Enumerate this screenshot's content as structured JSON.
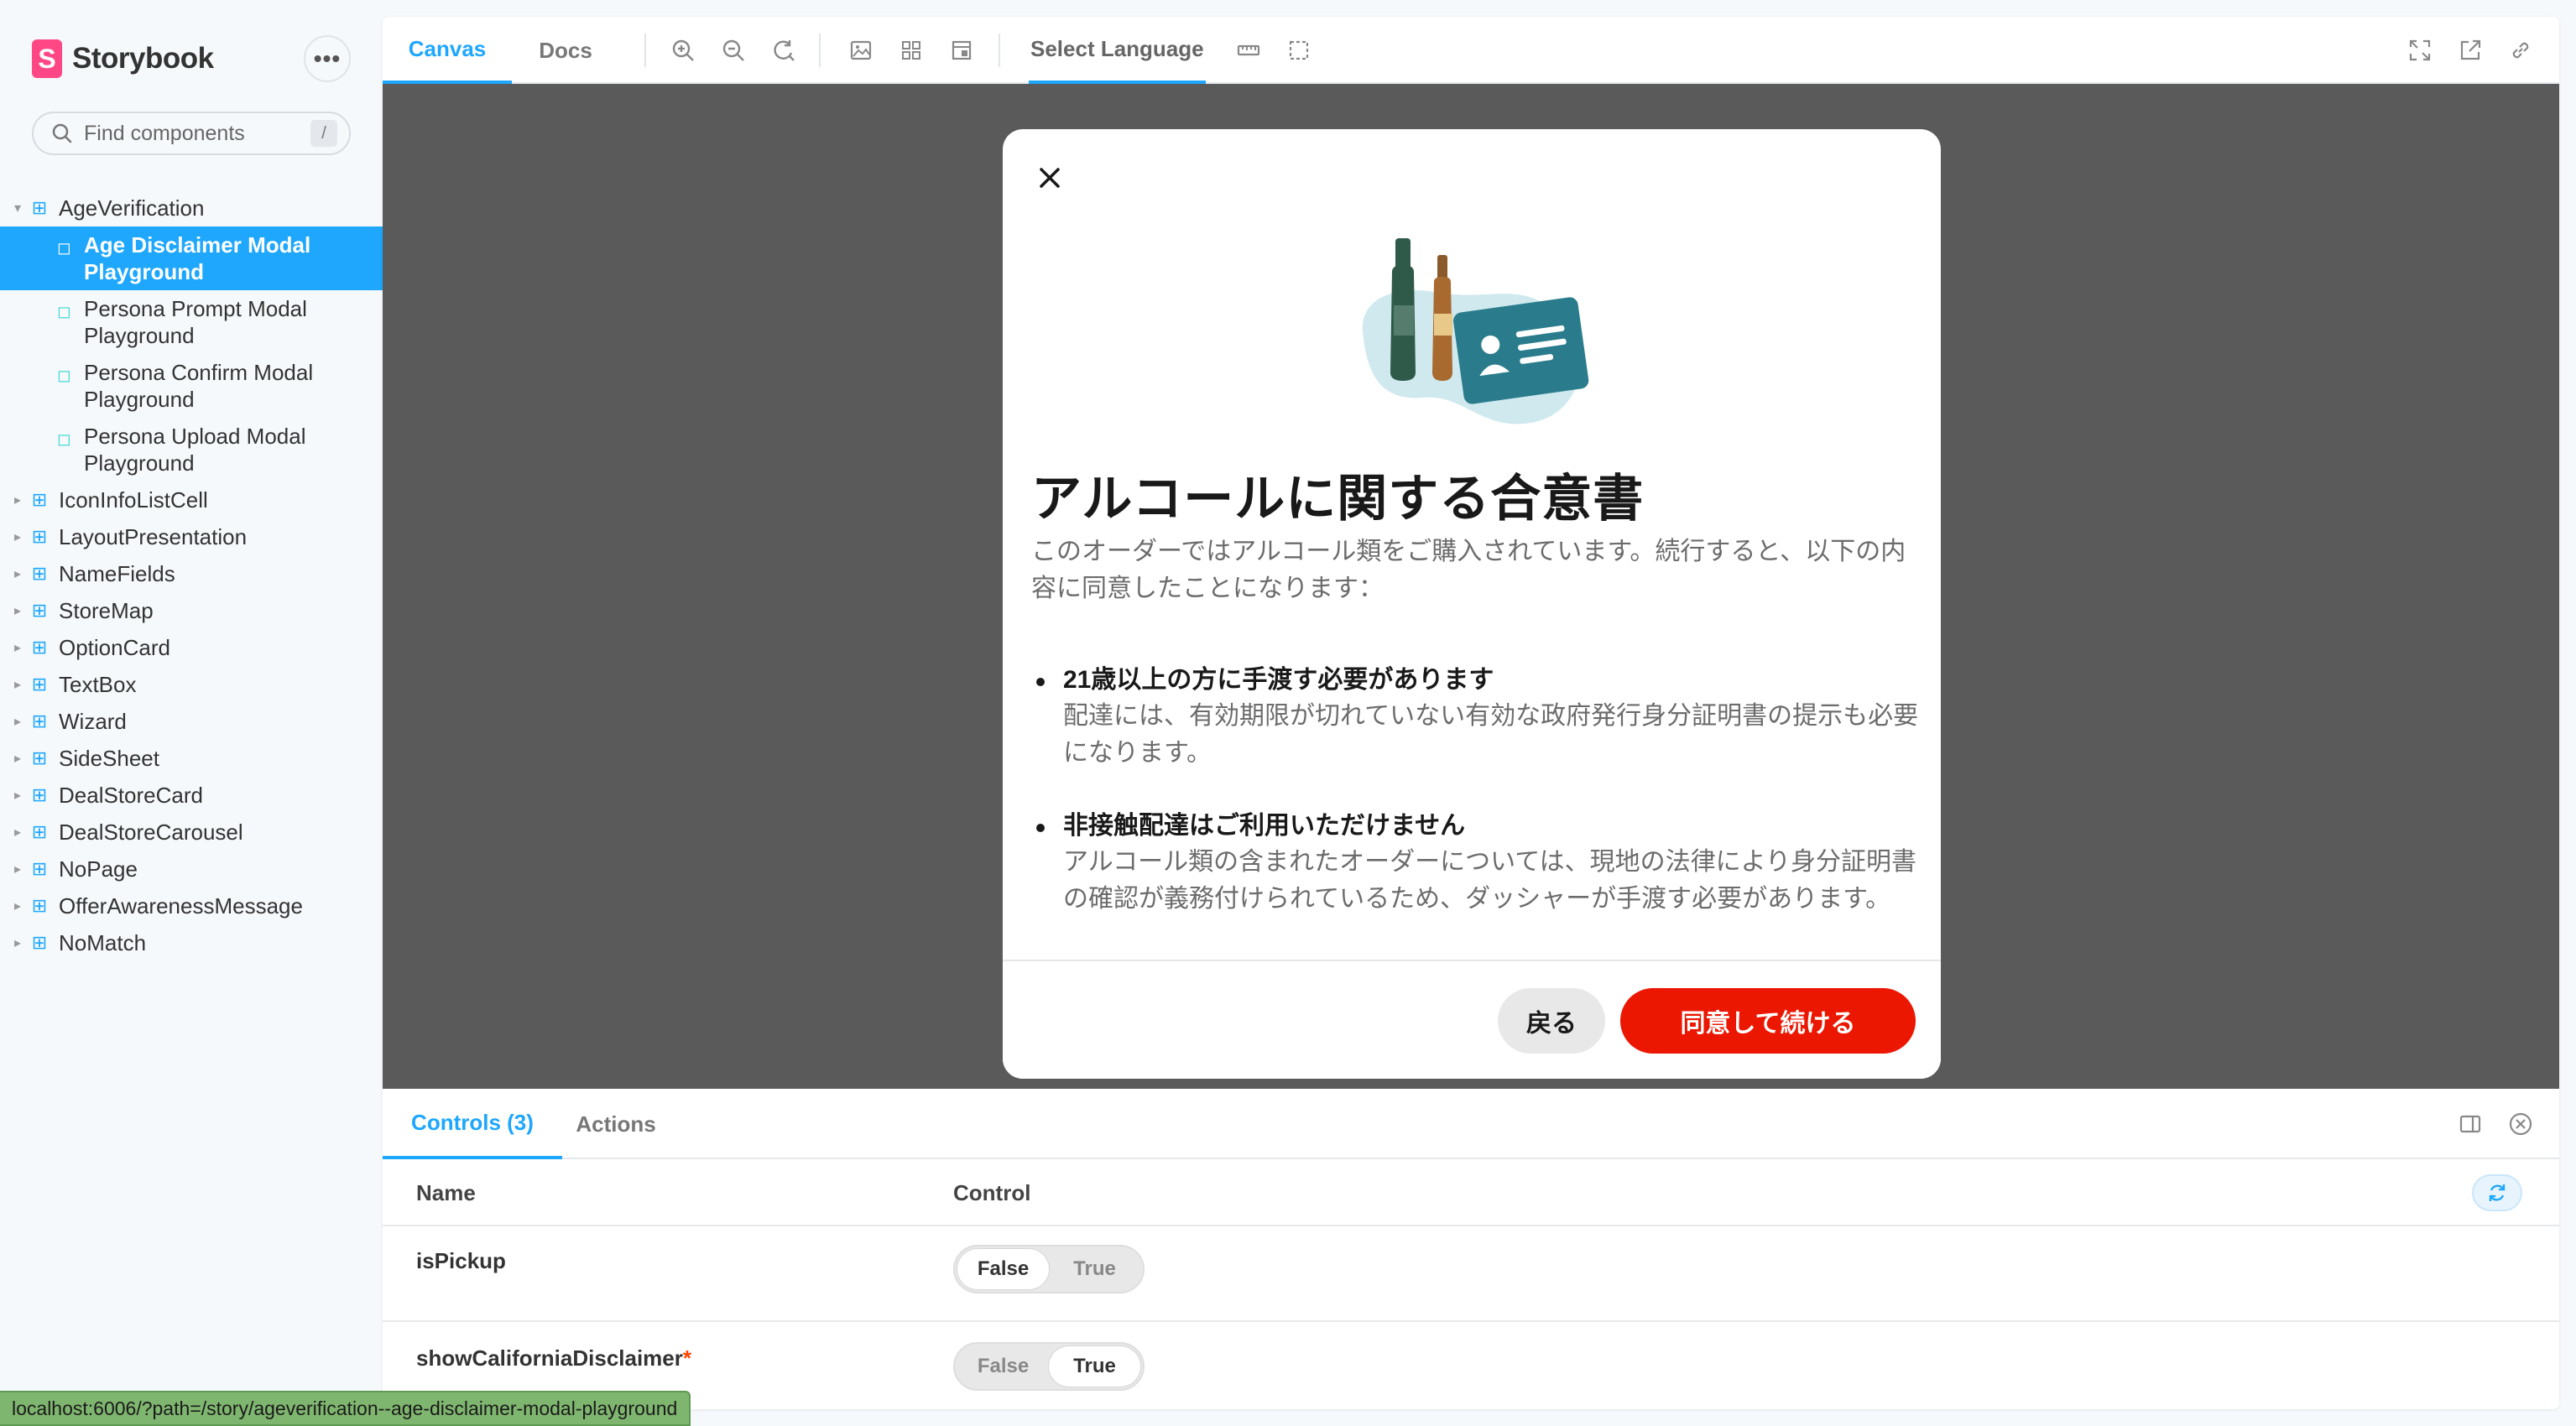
{
  "app": {
    "brand_name": "Storybook",
    "brand_letter": "S",
    "menu_label": "•••"
  },
  "search": {
    "placeholder": "Find components",
    "shortcut": "/"
  },
  "sidebar": {
    "groups": [
      {
        "label": "AgeVerification",
        "expanded": true
      },
      {
        "label": "IconInfoListCell"
      },
      {
        "label": "LayoutPresentation"
      },
      {
        "label": "NameFields"
      },
      {
        "label": "StoreMap"
      },
      {
        "label": "OptionCard"
      },
      {
        "label": "TextBox"
      },
      {
        "label": "Wizard"
      },
      {
        "label": "SideSheet"
      },
      {
        "label": "DealStoreCard"
      },
      {
        "label": "DealStoreCarousel"
      },
      {
        "label": "NoPage"
      },
      {
        "label": "OfferAwarenessMessage"
      },
      {
        "label": "NoMatch"
      }
    ],
    "stories": [
      {
        "label": "Age Disclaimer Modal Playground",
        "active": true
      },
      {
        "label": "Persona Prompt Modal Playground"
      },
      {
        "label": "Persona Confirm Modal Playground"
      },
      {
        "label": "Persona Upload Modal Playground"
      }
    ]
  },
  "toolbar": {
    "tabs": [
      {
        "label": "Canvas",
        "active": true
      },
      {
        "label": "Docs"
      }
    ],
    "language_label": "Select Language",
    "icons": [
      "zoom-in-icon",
      "zoom-out-icon",
      "zoom-reset-icon",
      "background-icon",
      "grid-icon",
      "viewport-icon",
      "ruler-icon",
      "outline-icon",
      "fullscreen-icon",
      "open-new-tab-icon",
      "copy-link-icon"
    ]
  },
  "modal": {
    "title": "アルコールに関する合意書",
    "intro": "このオーダーではアルコール類をご購入されています。続行すると、以下の内容に同意したことになります：",
    "bullets": [
      {
        "heading": "21歳以上の方に手渡す必要があります",
        "body": "配達には、有効期限が切れていない有効な政府発行身分証明書の提示も必要になります。"
      },
      {
        "heading": "非接触配達はご利用いただけません",
        "body": "アルコール類の含まれたオーダーについては、現地の法律により身分証明書の確認が義務付けられているため、ダッシャーが手渡す必要があります。"
      }
    ],
    "back_label": "戻る",
    "accept_label": "同意して続ける",
    "accent_color": "#eb1700"
  },
  "addons": {
    "tabs": [
      {
        "label": "Controls (3)",
        "active": true
      },
      {
        "label": "Actions"
      }
    ],
    "columns": {
      "name": "Name",
      "control": "Control"
    },
    "rows": [
      {
        "name": "isPickup",
        "required": false,
        "false_label": "False",
        "true_label": "True",
        "value": false
      },
      {
        "name": "showCaliforniaDisclaimer",
        "required": true,
        "required_mark": "*",
        "false_label": "False",
        "true_label": "True",
        "value": true
      }
    ]
  },
  "statusbar": {
    "url": "localhost:6006/?path=/story/ageverification--age-disclaimer-modal-playground"
  },
  "colors": {
    "storybook_accent": "#1ea7fd",
    "storybook_pink": "#ff4785"
  }
}
